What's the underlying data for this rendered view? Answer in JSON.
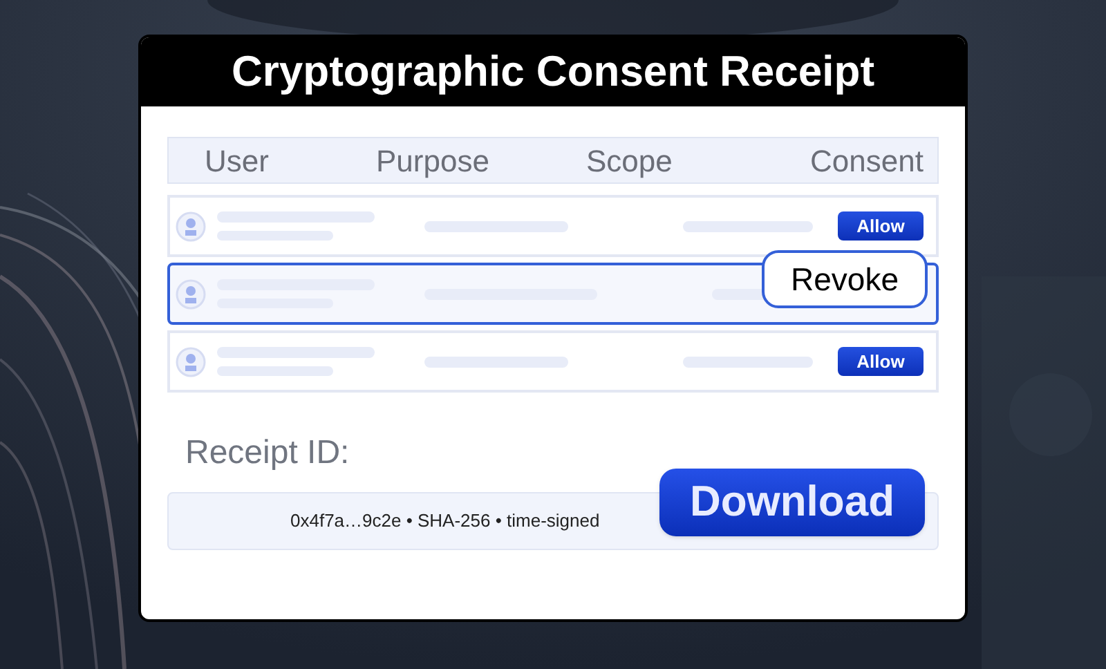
{
  "window": {
    "title": "Cryptographic Consent Receipt"
  },
  "table": {
    "columns": [
      "User",
      "Purpose",
      "Scope",
      "Consent"
    ],
    "rows": [
      {
        "selected": false,
        "consent": {
          "kind": "allow",
          "label": "Allow"
        }
      },
      {
        "selected": true,
        "consent": {
          "kind": "revoke",
          "label": "Revoke"
        }
      },
      {
        "selected": false,
        "consent": {
          "kind": "allow",
          "label": "Allow"
        }
      }
    ]
  },
  "receipt": {
    "label": "Receipt ID:",
    "value": "0x4f7a…9c2e • SHA-256 • time-signed"
  },
  "download_button": {
    "label": "Download"
  }
}
